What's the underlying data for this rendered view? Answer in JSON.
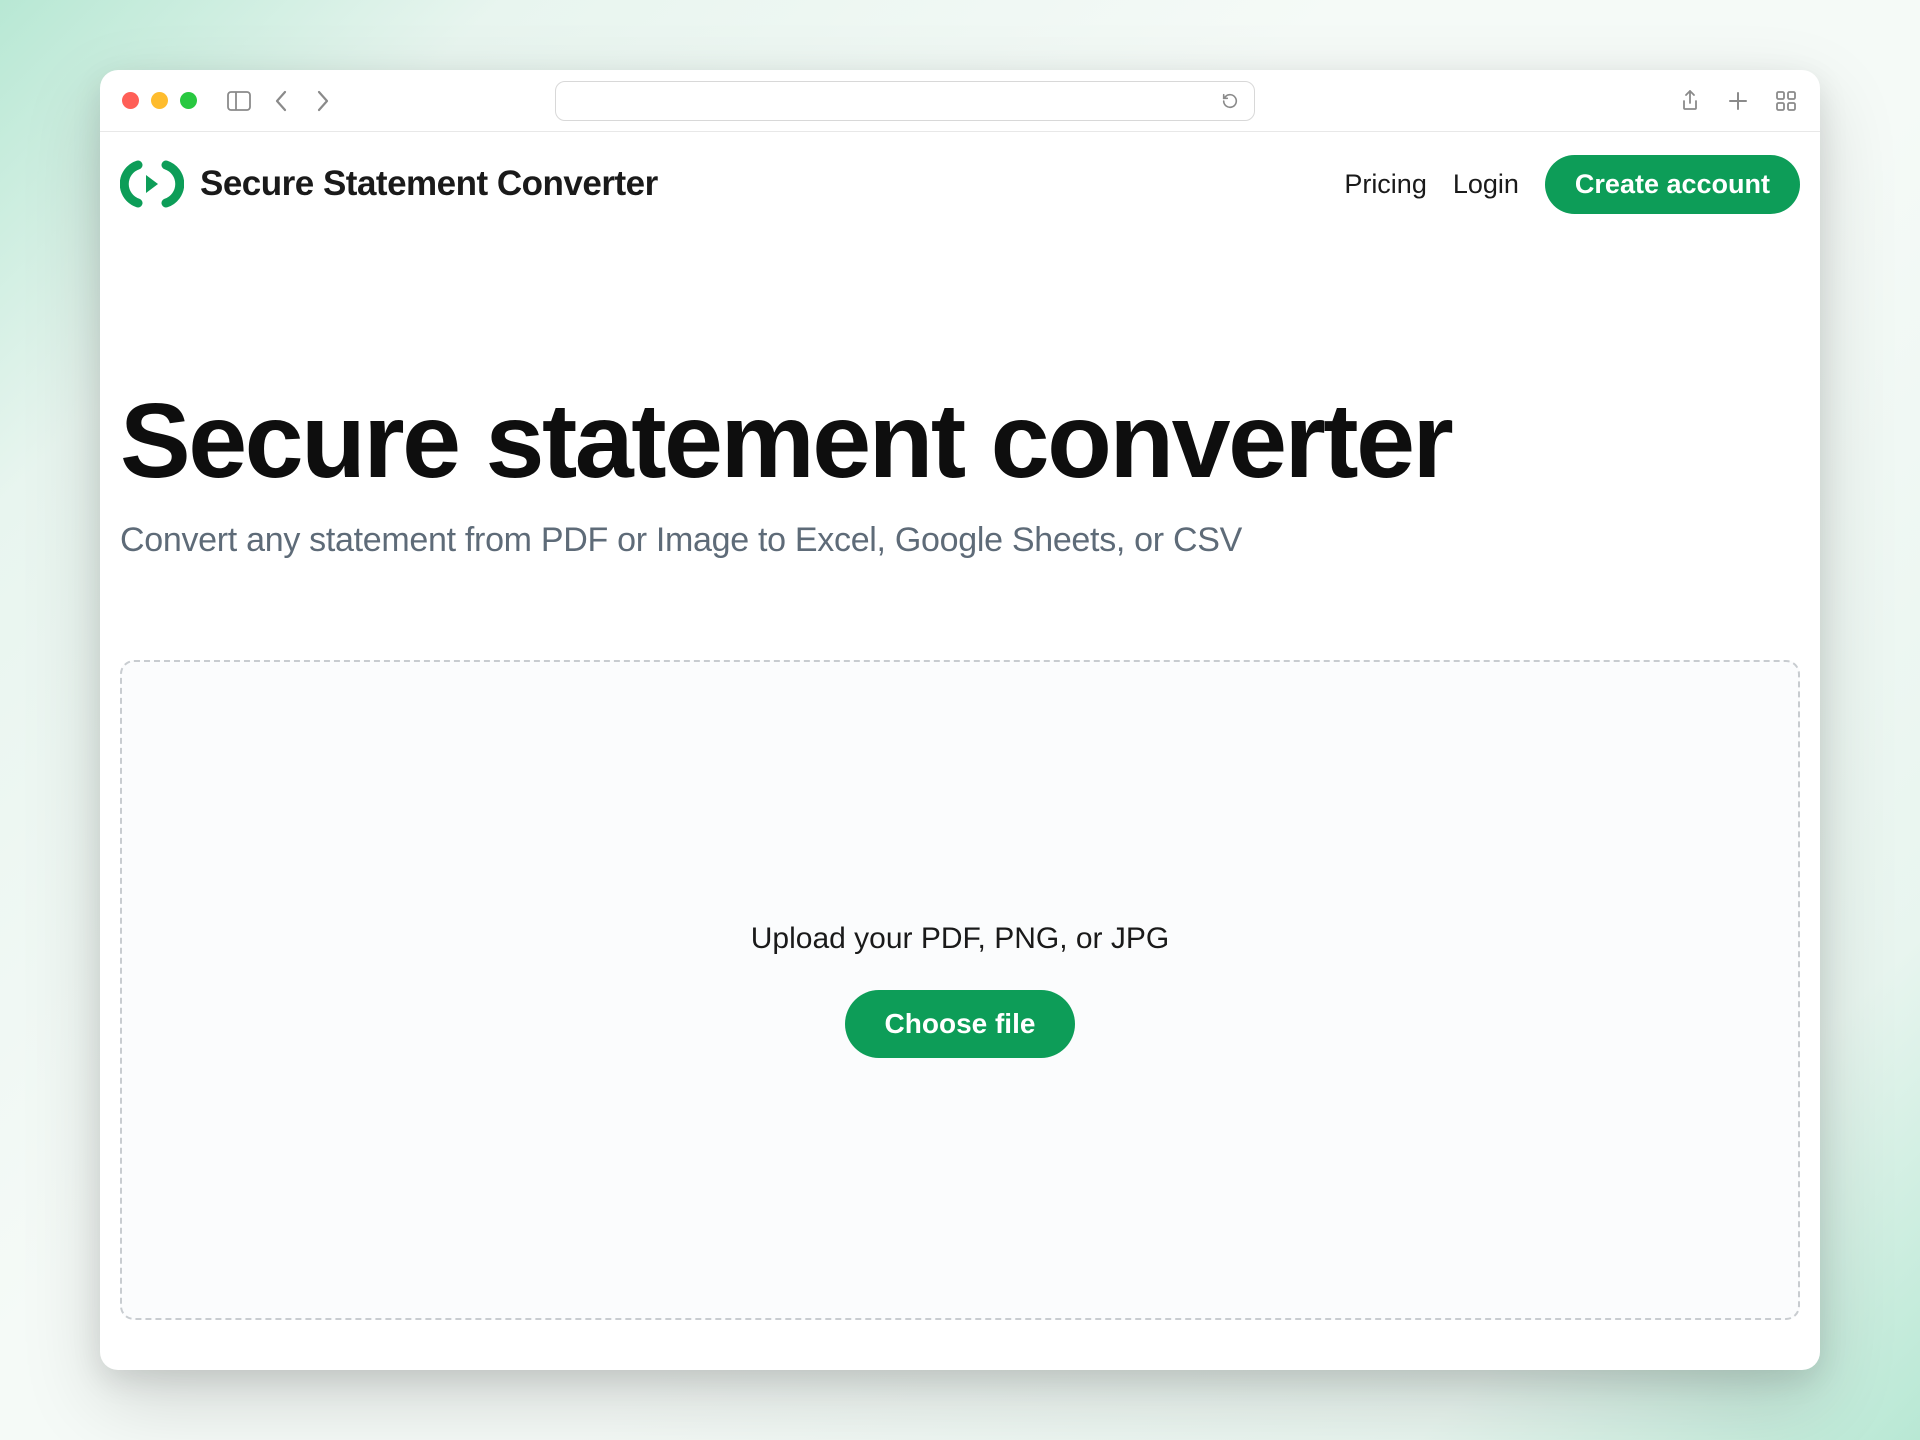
{
  "brand": {
    "name": "Secure Statement Converter"
  },
  "nav": {
    "pricing": "Pricing",
    "login": "Login",
    "create_account": "Create account"
  },
  "hero": {
    "title": "Secure statement converter",
    "subtitle": "Convert any statement from PDF or Image to Excel, Google Sheets, or CSV"
  },
  "dropzone": {
    "label": "Upload your PDF, PNG, or JPG",
    "choose_file": "Choose file"
  }
}
